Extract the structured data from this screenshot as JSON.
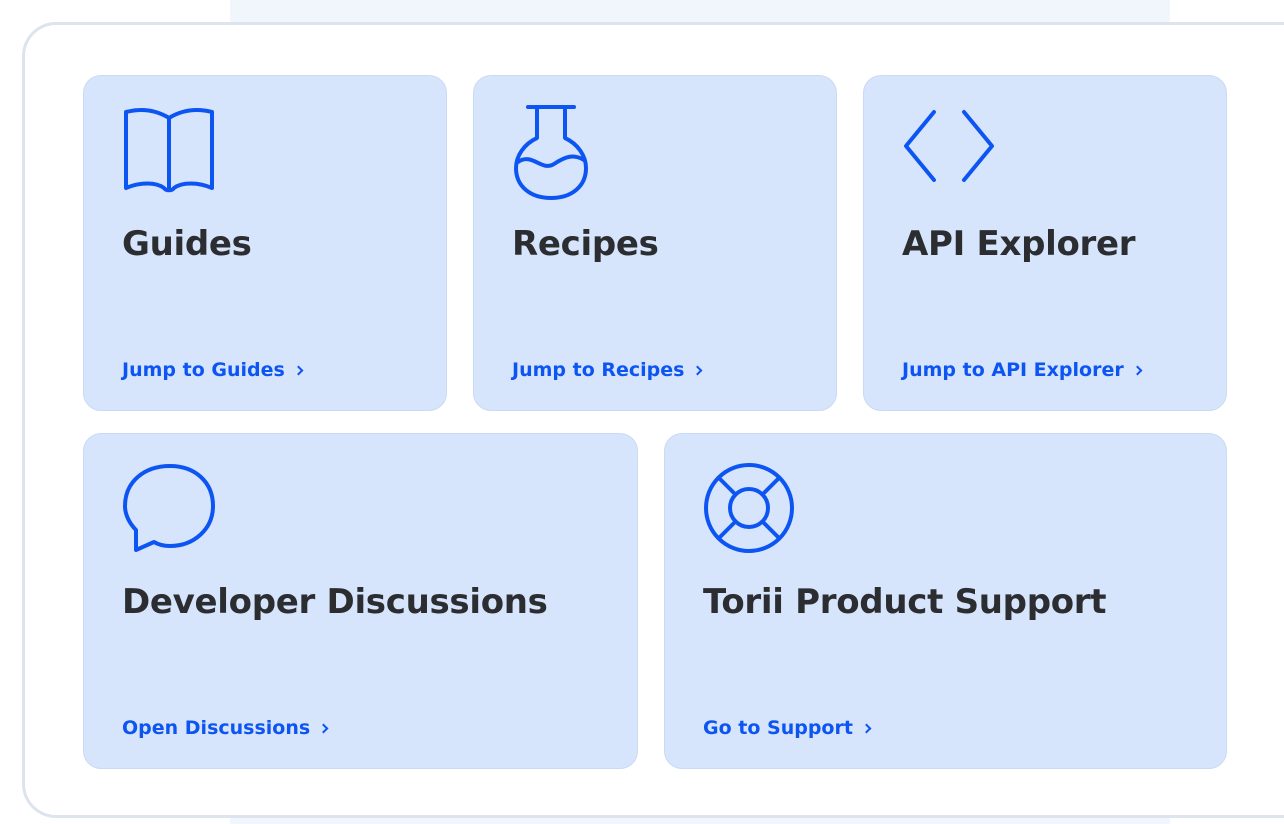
{
  "colors": {
    "card_bg": "#d7e5fc",
    "accent": "#0d55f2",
    "title": "#2b2d31",
    "panel_border": "#dde4ee"
  },
  "cards": [
    {
      "title": "Guides",
      "link": "Jump to Guides",
      "icon": "book-icon"
    },
    {
      "title": "Recipes",
      "link": "Jump to Recipes",
      "icon": "flask-icon"
    },
    {
      "title": "API Explorer",
      "link": "Jump to API Explorer",
      "icon": "code-brackets-icon"
    },
    {
      "title": "Developer Discussions",
      "link": "Open Discussions",
      "icon": "chat-bubble-icon"
    },
    {
      "title": "Torii Product Support",
      "link": "Go to Support",
      "icon": "lifebuoy-icon"
    }
  ]
}
